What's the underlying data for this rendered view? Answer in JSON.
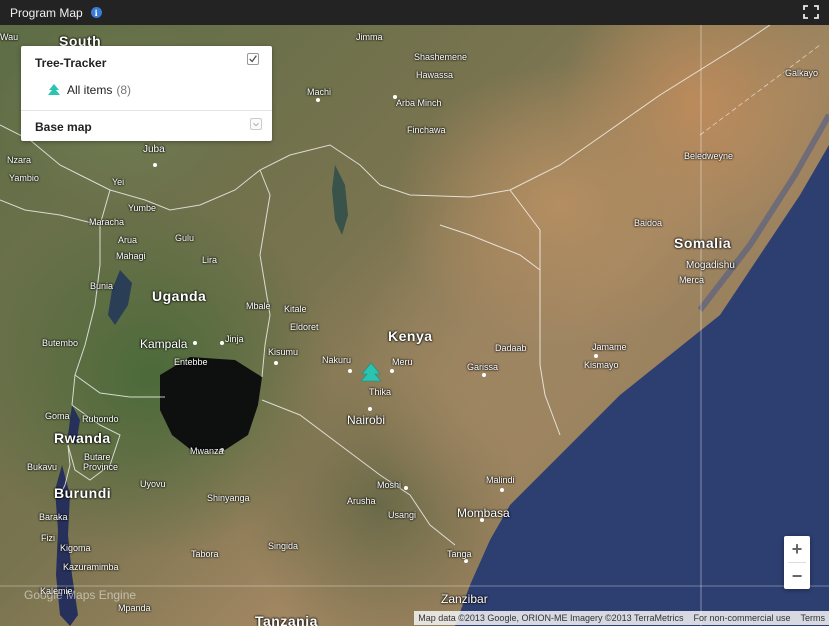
{
  "header": {
    "title": "Program Map",
    "info_icon": "info-icon",
    "fullscreen_icon": "fullscreen-icon"
  },
  "legend": {
    "layer_title": "Tree-Tracker",
    "layer_checked": true,
    "item_label": "All items",
    "item_count": "(8)",
    "item_icon": "tree-icon",
    "base_map_label": "Base map"
  },
  "zoom": {
    "in_label": "+",
    "out_label": "−"
  },
  "attribution": {
    "map_data": "Map data ©2013 Google, ORION-ME Imagery ©2013 TerraMetrics",
    "non_commercial": "For non-commercial use",
    "terms": "Terms"
  },
  "google_logo": "Google Maps Engine",
  "colors": {
    "marker": "#2bc4b0",
    "header_bg": "#232323",
    "ocean": "#2e3f6e"
  },
  "places": {
    "countries": [
      "South",
      "Uganda",
      "Kenya",
      "Somalia",
      "Rwanda",
      "Burundi",
      "Tanzania"
    ],
    "cities": [
      "Wau",
      "Jimma",
      "Shashemene",
      "Hawassa",
      "Machi",
      "Arba Minch",
      "Finchawa",
      "Galkayo",
      "Juba",
      "Nzara",
      "Yambio",
      "Yei",
      "Yumbe",
      "Maracha",
      "Arua",
      "Mahagi",
      "Gulu",
      "Lira",
      "Beledweyne",
      "Baidoa",
      "Mogadishu",
      "Merca",
      "Bunia",
      "Mbale",
      "Kitale",
      "Eldoret",
      "Kampala",
      "Jinja",
      "Entebbe",
      "Butembo",
      "Kisumu",
      "Nakuru",
      "Meru",
      "Dadaab",
      "Garissa",
      "Jamame",
      "Kismayo",
      "Thika",
      "Nairobi",
      "Goma",
      "Ruhondo",
      "Butare",
      "Bukavu",
      "Province",
      "Mwanza",
      "Uyovu",
      "Moshi",
      "Arusha",
      "Usangi",
      "Malindi",
      "Mombasa",
      "Shinyanga",
      "Baraka",
      "Fizi",
      "Kigoma",
      "Kazuramimba",
      "Tabora",
      "Singida",
      "Tanga",
      "Zanzibar",
      "Kalemie",
      "Mpanda"
    ]
  }
}
